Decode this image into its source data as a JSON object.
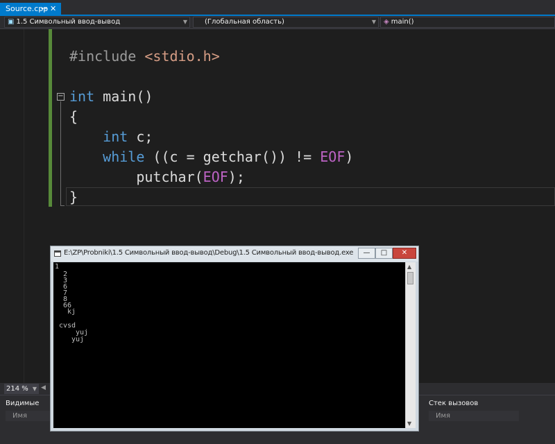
{
  "tab": {
    "title": "Source.cpp",
    "pin_icon": "pin-icon",
    "close_icon": "close-icon"
  },
  "navbar": {
    "project": "1.5 Символьный ввод-вывод",
    "scope": "(Глобальная область)",
    "member": "main()"
  },
  "code": [
    "#include <stdio.h>",
    "int main()",
    "{",
    "    int c;",
    "    while ((c = getchar()) != EOF)",
    "        putchar(EOF);",
    "}"
  ],
  "zoom": {
    "value": "214 %"
  },
  "panels": {
    "left": {
      "title": "Видимые",
      "column": "Имя"
    },
    "right": {
      "title": "Стек вызовов",
      "column": "Имя"
    }
  },
  "console": {
    "title": "E:\\ZP\\Probniki\\1.5 Символьный ввод-вывод\\Debug\\1.5 Символьный ввод-вывод.exe",
    "buttons": {
      "minimize": "—",
      "maximize": "□",
      "close": "✕"
    },
    "lines": [
      "1",
      "2",
      "3",
      "6",
      "7",
      "8",
      "66",
      "kj",
      "",
      "cvsd",
      "yuj",
      "yuj"
    ]
  },
  "colors": {
    "accent": "#007acc",
    "editor_bg": "#1e1e1e",
    "keyword": "#569cd6",
    "macro": "#bd63c5",
    "string": "#d69d85",
    "change_marker": "#578a3a"
  }
}
